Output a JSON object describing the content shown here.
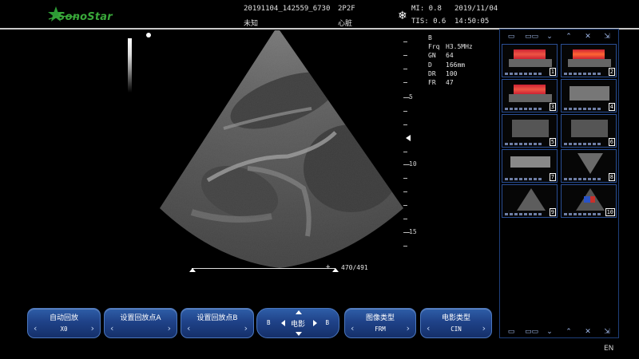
{
  "header": {
    "logo_text": "SonoStar",
    "exam_id": "20191104_142559_6730",
    "patient_name": "未知",
    "probe": "2P2F",
    "exam_type": "心脏",
    "freeze_icon": "snowflake-icon",
    "mi": "MI: 0.8",
    "tis": "TIS: 0.6",
    "date": "2019/11/04",
    "time": "14:50:05"
  },
  "params": {
    "mode": "B",
    "rows": [
      {
        "key": "Frq",
        "value": "H3.5MHz"
      },
      {
        "key": "GN",
        "value": "64"
      },
      {
        "key": "D",
        "value": "166mm"
      },
      {
        "key": "DR",
        "value": "100"
      },
      {
        "key": "FR",
        "value": "47"
      }
    ]
  },
  "depth_scale": {
    "labels": [
      "5",
      "10",
      "15"
    ]
  },
  "cine": {
    "counter": "470/491",
    "marker": "+"
  },
  "buttons": [
    {
      "label": "自动回放",
      "value": "X0"
    },
    {
      "label": "设置回放点A",
      "value": ""
    },
    {
      "label": "设置回放点B",
      "value": ""
    },
    {
      "label": "图像类型",
      "value": "FRM"
    },
    {
      "label": "电影类型",
      "value": "CIN"
    }
  ],
  "cine_pad": {
    "label": "电影",
    "left": "B",
    "right": "B"
  },
  "thumbnails": {
    "numbers": [
      "1",
      "2",
      "3",
      "4",
      "5",
      "6",
      "7",
      "8",
      "9",
      "10"
    ]
  },
  "language": "EN",
  "colors": {
    "brand_green": "#39a83a",
    "button_blue": "#1f4288",
    "panel_border": "#1f3f7a"
  }
}
